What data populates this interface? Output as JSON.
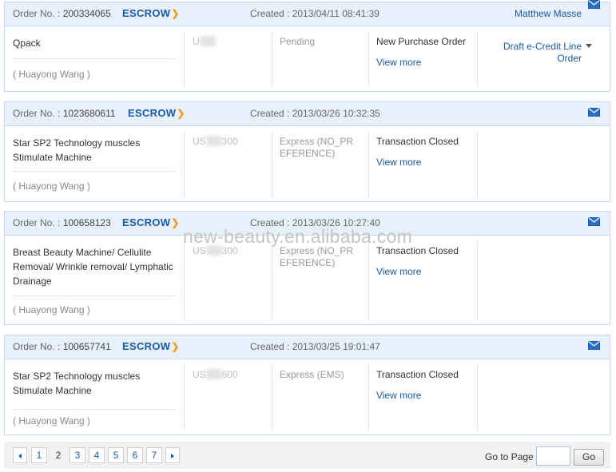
{
  "colors": {
    "link": "#1a5aa8",
    "header_bg": "#e8f1fb",
    "border": "#c8d9ea",
    "escrow_arrow": "#f0a020"
  },
  "order_no_label": "Order No. :",
  "escrow_label": "ESCROW",
  "created_label": "Created :",
  "view_more_label": "View more",
  "orders": [
    {
      "order_no": "200334065",
      "created": "2013/04/11 08:41:39",
      "buyer": "Matthew Masse",
      "product": "Qpack",
      "seller": "( Huayong Wang )",
      "price_prefix": "U",
      "price_suffix": "",
      "shipping": "",
      "status": "Pending",
      "trade_status": "New Purchase Order",
      "action_line1": "Draft e-Credit Line",
      "action_line2": "Order",
      "icon": "mail-icon"
    },
    {
      "order_no": "1023680611",
      "created": "2013/03/26 10:32:35",
      "product": "Star SP2 Technology muscles Stimulate Machine",
      "seller": "( Huayong Wang )",
      "price_prefix": "US",
      "price_suffix": "300",
      "shipping": "Express (NO_PREFERENCE)",
      "trade_status": "Transaction Closed",
      "icon": "mail-icon"
    },
    {
      "order_no": "100658123",
      "created": "2013/03/26 10:27:40",
      "product": "Breast Beauty Machine/ Cellulite Removal/ Wrinkle removal/ Lymphatic Drainage",
      "seller": "( Huayong Wang )",
      "price_prefix": "US",
      "price_suffix": "300",
      "shipping": "Express (NO_PREFERENCE)",
      "trade_status": "Transaction Closed",
      "icon": "mail-icon"
    },
    {
      "order_no": "100657741",
      "created": "2013/03/25 19:01:47",
      "product": "Star SP2 Technology muscles Stimulate Machine",
      "seller": "( Huayong Wang )",
      "price_prefix": "US",
      "price_suffix": "600",
      "shipping": "Express (EMS)",
      "trade_status": "Transaction Closed",
      "icon": "mail-icon"
    }
  ],
  "watermark": "new-beauty.en.alibaba.com",
  "pagination": {
    "pages": [
      "1",
      "2",
      "3",
      "4",
      "5",
      "6",
      "7"
    ],
    "current_page": "2",
    "goto_label": "Go to Page",
    "goto_value": "",
    "go_button": "Go",
    "prev_icon": "chevron-left-icon",
    "next_icon": "chevron-right-icon"
  }
}
